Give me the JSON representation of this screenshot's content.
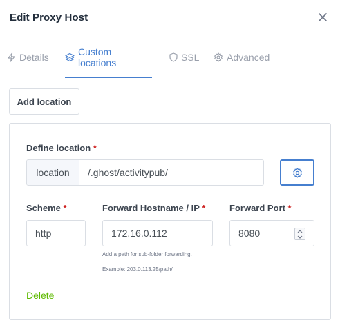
{
  "modal": {
    "title": "Edit Proxy Host",
    "close_icon": "close-icon"
  },
  "tabs": [
    {
      "label": "Details",
      "icon": "lightning-icon",
      "active": false
    },
    {
      "label": "Custom locations",
      "icon": "layers-icon",
      "active": true
    },
    {
      "label": "SSL",
      "icon": "shield-icon",
      "active": false
    },
    {
      "label": "Advanced",
      "icon": "gear-icon",
      "active": false
    }
  ],
  "add_location_label": "Add location",
  "location": {
    "define_label": "Define location",
    "required_mark": "*",
    "addon": "location",
    "path_value": "/.ghost/activitypub/",
    "settings_icon": "gear-icon"
  },
  "scheme": {
    "label": "Scheme",
    "value": "http"
  },
  "forward_host": {
    "label": "Forward Hostname / IP",
    "value": "172.16.0.112",
    "help": "Add a path for sub-folder forwarding.",
    "example": "Example: 203.0.113.25/path/"
  },
  "forward_port": {
    "label": "Forward Port",
    "value": "8080"
  },
  "delete_label": "Delete",
  "colors": {
    "accent": "#467fcf",
    "required": "#cd201f",
    "delete": "#5eba00",
    "muted": "#9aa0ac"
  }
}
